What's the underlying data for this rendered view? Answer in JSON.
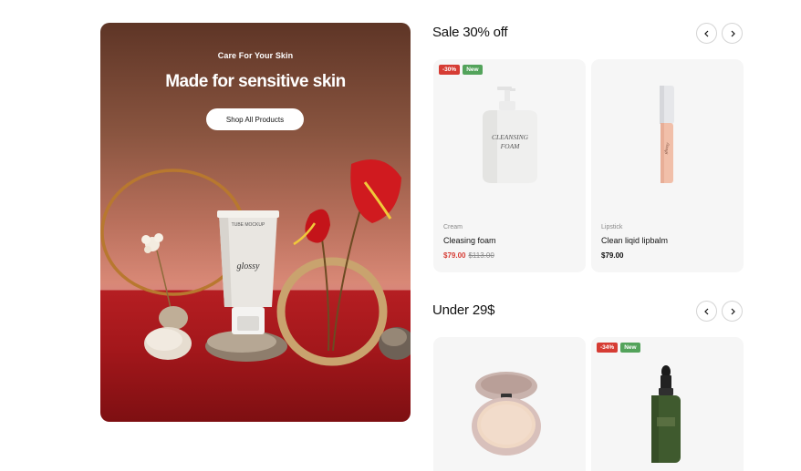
{
  "hero": {
    "eyebrow": "Care For Your Skin",
    "title": "Made for sensitive skin",
    "button_label": "Shop All Products",
    "product_text_top": "TUBE MOCKUP",
    "product_brand": "glossy"
  },
  "sections": [
    {
      "title": "Sale 30% off",
      "products": [
        {
          "badges": [
            "-30%",
            "New"
          ],
          "category": "Cream",
          "name": "Cleasing foam",
          "price": "$79.00",
          "old_price": "$113.00",
          "label_line1": "CLEANSING",
          "label_line2": "FOAM"
        },
        {
          "badges": [],
          "category": "Lipstick",
          "name": "Clean liqid lipbalm",
          "price": "$79.00",
          "label": "glossy"
        }
      ]
    },
    {
      "title": "Under 29$",
      "products": [
        {
          "badges": []
        },
        {
          "badges": [
            "-34%",
            "New"
          ]
        }
      ]
    }
  ],
  "colors": {
    "sale_badge": "#d63c34",
    "new_badge": "#53a35b",
    "card_bg": "#f6f6f6"
  },
  "icons": {
    "prev": "chevron-left-icon",
    "next": "chevron-right-icon"
  }
}
